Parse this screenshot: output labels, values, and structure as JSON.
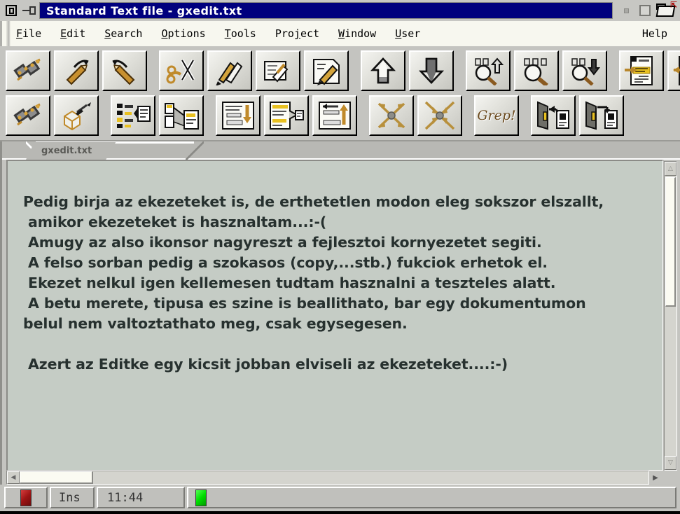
{
  "window": {
    "title": "Standard Text file - gxedit.txt",
    "system_menu_icon": "window-menu-icon",
    "pin_icon": "pin-icon",
    "minimize_label": "",
    "maximize_label": "",
    "restore_icon": "folder-zoom-icon"
  },
  "menubar": {
    "items": [
      {
        "label": "File",
        "mnemonic": "F"
      },
      {
        "label": "Edit",
        "mnemonic": "E"
      },
      {
        "label": "Search",
        "mnemonic": "S"
      },
      {
        "label": "Options",
        "mnemonic": "O"
      },
      {
        "label": "Tools",
        "mnemonic": "T"
      },
      {
        "label": "Project",
        "mnemonic": "j"
      },
      {
        "label": "Window",
        "mnemonic": "W"
      },
      {
        "label": "User",
        "mnemonic": "U"
      }
    ],
    "help": "Help"
  },
  "toolbar_row1": [
    {
      "name": "chain-tools-icon",
      "tip": "Tools"
    },
    {
      "name": "undo-arrow-icon",
      "tip": "Undo"
    },
    {
      "name": "redo-arrow-icon",
      "tip": "Redo"
    },
    {
      "name": "cut-scissors-icon",
      "tip": "Cut"
    },
    {
      "name": "copy-icon",
      "tip": "Copy"
    },
    {
      "name": "paste-icon",
      "tip": "Paste"
    },
    {
      "name": "edit-page-icon",
      "tip": "Edit"
    },
    {
      "name": "arrow-up-icon",
      "tip": "Previous"
    },
    {
      "name": "arrow-down-icon",
      "tip": "Next"
    },
    {
      "name": "find-up-icon",
      "tip": "Find previous"
    },
    {
      "name": "find-icon",
      "tip": "Find"
    },
    {
      "name": "find-down-icon",
      "tip": "Find next"
    },
    {
      "name": "goto-forward-icon",
      "tip": "Go forward"
    },
    {
      "name": "goto-back-icon",
      "tip": "Go back"
    }
  ],
  "toolbar_row2": [
    {
      "name": "chain-tools-icon",
      "tip": "Build tools"
    },
    {
      "name": "compile-cube-icon",
      "tip": "Compile"
    },
    {
      "name": "doc-detail-icon",
      "tip": "Document info"
    },
    {
      "name": "doc-expand-icon",
      "tip": "Expand document"
    },
    {
      "name": "doc-insert-icon",
      "tip": "Insert"
    },
    {
      "name": "doc-extract-icon",
      "tip": "Extract"
    },
    {
      "name": "doc-merge-icon",
      "tip": "Merge"
    },
    {
      "name": "expand-arrows-icon",
      "tip": "Expand"
    },
    {
      "name": "collapse-arrows-icon",
      "tip": "Collapse"
    },
    {
      "name": "grep-button",
      "tip": "Grep",
      "label": "Grep!"
    },
    {
      "name": "archive-extract-icon",
      "tip": "Extract archive"
    },
    {
      "name": "archive-store-icon",
      "tip": "Store archive"
    }
  ],
  "tabs": [
    {
      "label": "gxedit.txt",
      "active": true
    }
  ],
  "document": {
    "lines": [
      "Pedig birja az ekezeteket is, de erthetetlen modon eleg sokszor elszallt,",
      " amikor ekezeteket is hasznaltam...:-(",
      " Amugy az also ikonsor nagyreszt a fejlesztoi kornyezetet segiti.",
      " A felso sorban pedig a szokasos (copy,...stb.) fukciok erhetok el.",
      " Ekezet nelkul igen kellemesen tudtam hasznalni a teszteles alatt.",
      " A betu merete, tipusa es szine is beallithato, bar egy dokumentumon",
      "belul nem valtoztathato meg, csak egysegesen.",
      "",
      " Azert az Editke egy kicsit jobban elviseli az ekezeteket....:-)"
    ]
  },
  "scrollbars": {
    "vertical_up_glyph": "△",
    "vertical_down_glyph": "▽",
    "horizontal_left_glyph": "◀",
    "horizontal_right_glyph": "▶"
  },
  "statusbar": {
    "modified_led": "red",
    "insert_mode": "Ins",
    "time": "11:44",
    "activity_led": "green",
    "message": ""
  },
  "colors": {
    "title_bar": "#00007e",
    "window_face": "#c4c4c0",
    "menu_face": "#f7f7ef",
    "text_area": "#c5ccc5",
    "text_color": "#27312f",
    "led_red": "#9c1414",
    "led_green": "#00dd00"
  }
}
